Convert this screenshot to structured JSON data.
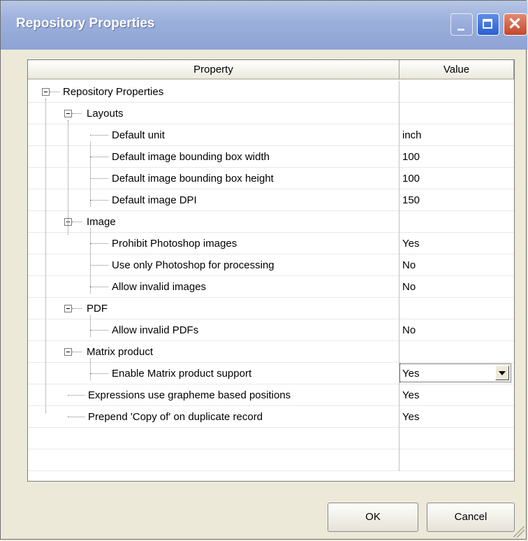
{
  "window": {
    "title": "Repository Properties",
    "minimize_glyph": "",
    "maximize_glyph": "",
    "close_glyph": "✕"
  },
  "grid": {
    "columns": [
      "Property",
      "Value"
    ],
    "rows": [
      {
        "label": "Repository Properties",
        "value": ""
      },
      {
        "label": "Layouts",
        "value": ""
      },
      {
        "label": "Default unit",
        "value": "inch"
      },
      {
        "label": "Default image bounding box width",
        "value": "100"
      },
      {
        "label": "Default image bounding box height",
        "value": "100"
      },
      {
        "label": "Default image DPI",
        "value": "150"
      },
      {
        "label": "Image",
        "value": ""
      },
      {
        "label": "Prohibit Photoshop images",
        "value": "Yes"
      },
      {
        "label": "Use only Photoshop for processing",
        "value": "No"
      },
      {
        "label": "Allow invalid images",
        "value": "No"
      },
      {
        "label": "PDF",
        "value": ""
      },
      {
        "label": "Allow invalid PDFs",
        "value": "No"
      },
      {
        "label": "Matrix product",
        "value": ""
      },
      {
        "label": "Enable Matrix product support",
        "value": "Yes"
      },
      {
        "label": "Expressions use grapheme based positions",
        "value": "Yes"
      },
      {
        "label": "Prepend 'Copy of' on duplicate record",
        "value": "Yes"
      }
    ]
  },
  "buttons": {
    "ok": "OK",
    "cancel": "Cancel"
  },
  "colors": {
    "titlebar": "#9cb0dc",
    "dialog_bg": "#ece9d8",
    "close_button": "#c4472a"
  },
  "icons": [
    "collapse-icon",
    "minimize-icon",
    "maximize-icon",
    "close-icon",
    "dropdown-arrow-icon",
    "resize-grip-icon"
  ]
}
